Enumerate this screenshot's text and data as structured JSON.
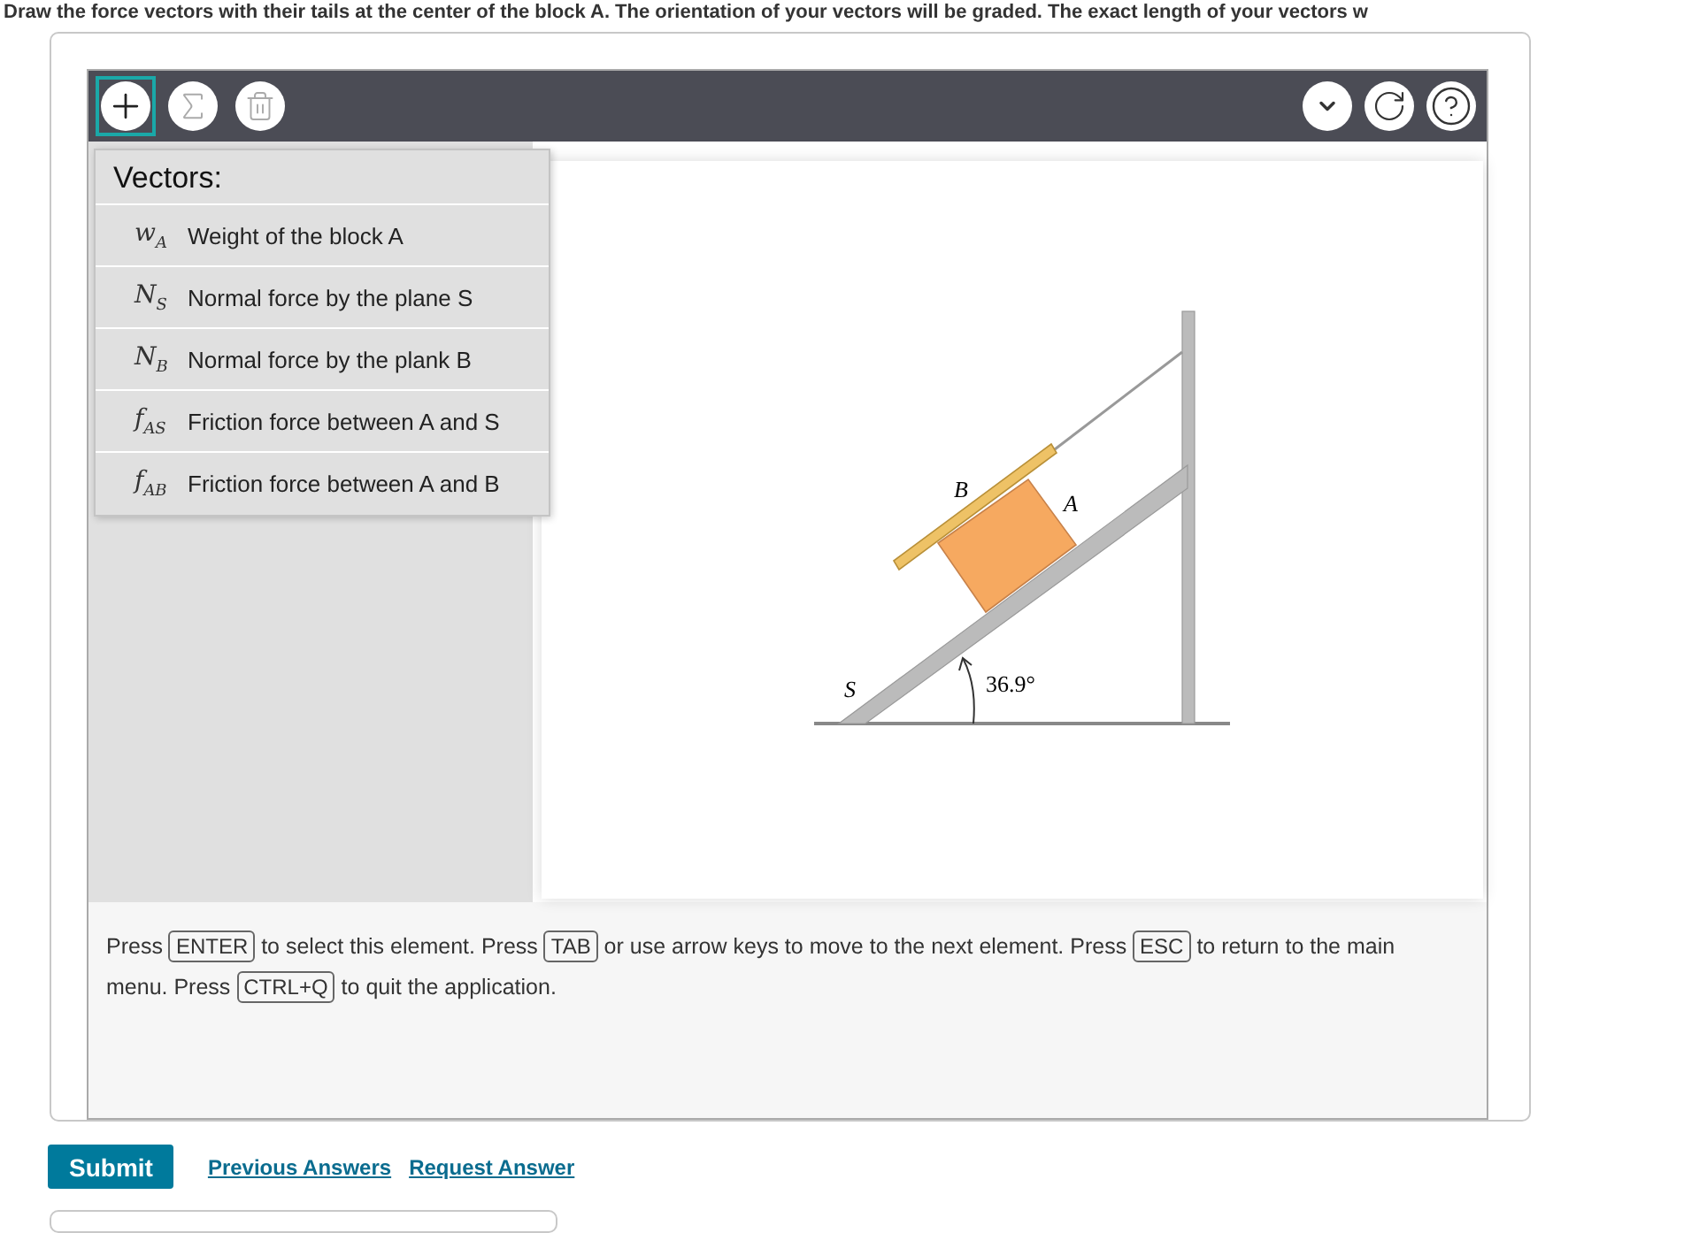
{
  "question_text": "Draw the force vectors with their tails at the center of the block A. The orientation of your vectors will be graded. The exact length of your vectors w",
  "toolbar": {
    "left_tools": [
      {
        "kind": "plus",
        "selected": true
      },
      {
        "kind": "sigma",
        "selected": false
      },
      {
        "kind": "trash",
        "selected": false
      }
    ],
    "right_tools": [
      {
        "kind": "chevron"
      },
      {
        "kind": "reset"
      },
      {
        "kind": "help"
      }
    ]
  },
  "vectors_menu": {
    "title": "Vectors:",
    "items": [
      {
        "symbol": "w",
        "sub": "A",
        "label": "Weight of the block A"
      },
      {
        "symbol": "N",
        "sub": "S",
        "label": "Normal force by the plane S"
      },
      {
        "symbol": "N",
        "sub": "B",
        "label": "Normal force by the plank B"
      },
      {
        "symbol": "f",
        "sub": "AS",
        "label": "Friction force between A and S"
      },
      {
        "symbol": "f",
        "sub": "AB",
        "label": "Friction force between A and B"
      }
    ]
  },
  "diagram": {
    "label_b": "B",
    "label_a": "A",
    "label_s": "S",
    "angle": "36.9°"
  },
  "instructions": [
    {
      "kind": "text",
      "text": "Press "
    },
    {
      "kind": "key",
      "text": "ENTER"
    },
    {
      "kind": "text",
      "text": " to select this element. Press "
    },
    {
      "kind": "key",
      "text": "TAB"
    },
    {
      "kind": "text",
      "text": " or use arrow keys to move to the next element. Press "
    },
    {
      "kind": "key",
      "text": "ESC"
    },
    {
      "kind": "text",
      "text": " to return to the main menu. Press "
    },
    {
      "kind": "key",
      "text": "CTRL+Q"
    },
    {
      "kind": "text",
      "text": " to quit the application."
    }
  ],
  "actions": {
    "submit": "Submit",
    "links": [
      "Previous Answers",
      "Request Answer"
    ]
  }
}
